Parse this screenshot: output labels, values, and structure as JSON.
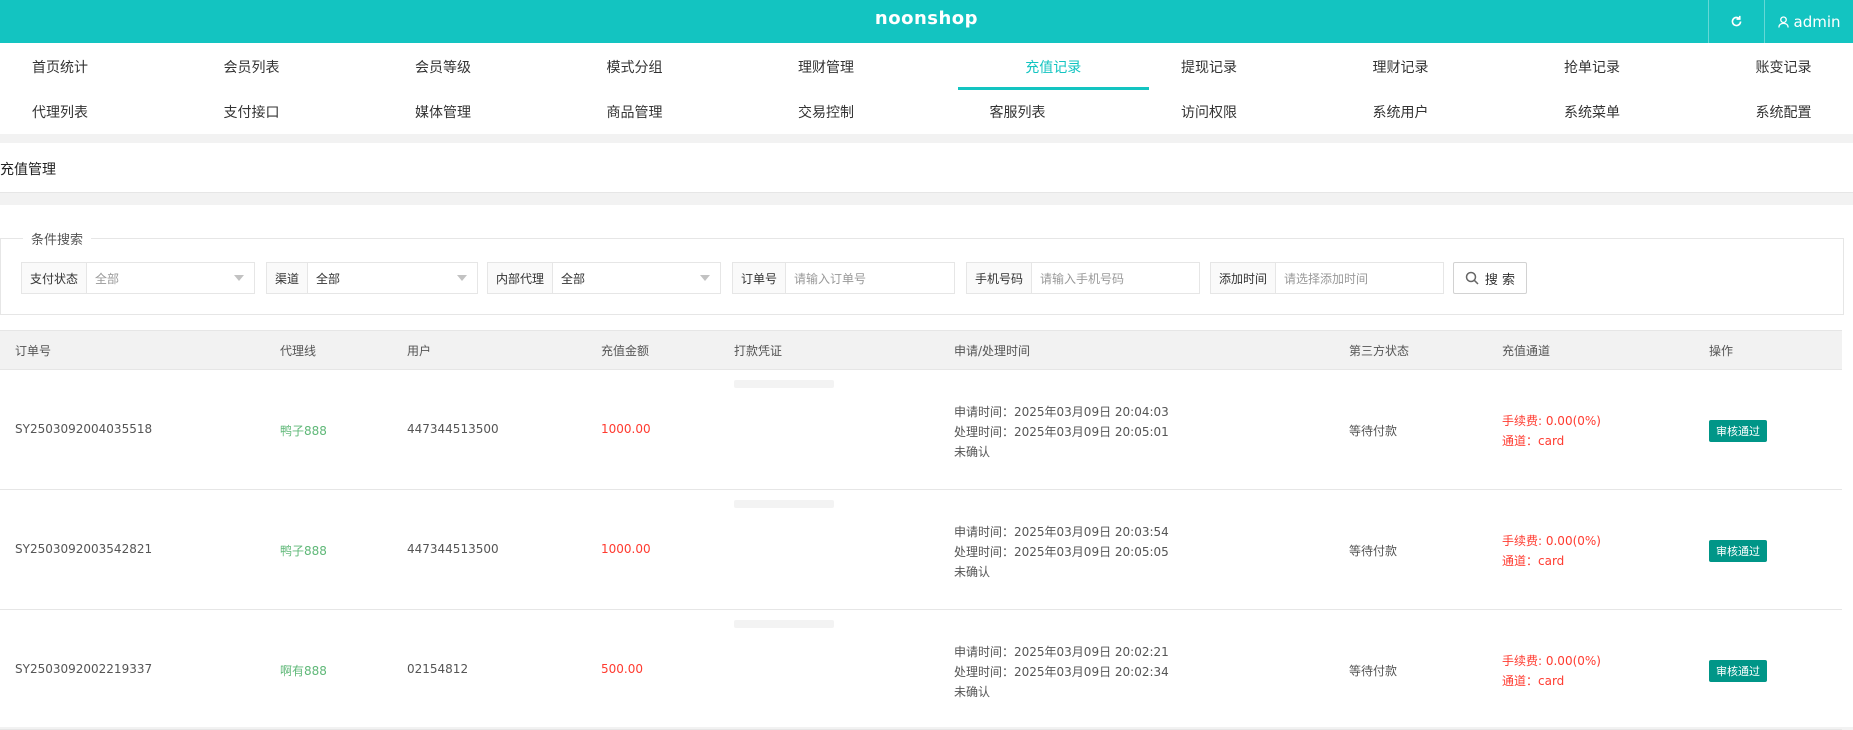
{
  "header": {
    "brand": "noonshop",
    "user": "admin",
    "refresh_icon": "refresh-icon",
    "user_icon": "user-icon"
  },
  "nav": {
    "row1": [
      "首页统计",
      "会员列表",
      "会员等级",
      "模式分组",
      "理财管理",
      "充值记录",
      "提现记录",
      "理财记录",
      "抢单记录",
      "账变记录"
    ],
    "row2": [
      "代理列表",
      "支付接口",
      "媒体管理",
      "商品管理",
      "交易控制",
      "客服列表",
      "访问权限",
      "系统用户",
      "系统菜单",
      "系统配置"
    ],
    "active": "充值记录"
  },
  "section": {
    "title": "充值管理"
  },
  "search": {
    "legend": "条件搜索",
    "pay_status": {
      "label": "支付状态",
      "value": "全部"
    },
    "channel": {
      "label": "渠道",
      "value": "全部"
    },
    "internal_agent": {
      "label": "内部代理",
      "value": "全部"
    },
    "order_no": {
      "label": "订单号",
      "placeholder": "请输入订单号"
    },
    "phone": {
      "label": "手机号码",
      "placeholder": "请输入手机号码"
    },
    "add_time": {
      "label": "添加时间",
      "placeholder": "请选择添加时间"
    },
    "button": "搜 索"
  },
  "table": {
    "columns": [
      "订单号",
      "代理线",
      "用户",
      "充值金额",
      "打款凭证",
      "申请/处理时间",
      "第三方状态",
      "充值通道",
      "操作"
    ],
    "rows": [
      {
        "order": "SY2503092004035518",
        "agent": "鸭子888",
        "user": "447344513500",
        "amount": "1000.00",
        "apply": "申请时间：2025年03月09日 20:04:03",
        "process": "处理时间：2025年03月09日 20:05:01",
        "confirm": "未确认",
        "third": "等待付款",
        "fee": "手续费: 0.00(0%)",
        "channel": "通道：card",
        "action": "审核通过"
      },
      {
        "order": "SY2503092003542821",
        "agent": "鸭子888",
        "user": "447344513500",
        "amount": "1000.00",
        "apply": "申请时间：2025年03月09日 20:03:54",
        "process": "处理时间：2025年03月09日 20:05:05",
        "confirm": "未确认",
        "third": "等待付款",
        "fee": "手续费: 0.00(0%)",
        "channel": "通道：card",
        "action": "审核通过"
      },
      {
        "order": "SY2503092002219337",
        "agent": "啊有888",
        "user": "02154812",
        "amount": "500.00",
        "apply": "申请时间：2025年03月09日 20:02:21",
        "process": "处理时间：2025年03月09日 20:02:34",
        "confirm": "未确认",
        "third": "等待付款",
        "fee": "手续费: 0.00(0%)",
        "channel": "通道：card",
        "action": "审核通过"
      }
    ]
  },
  "colors": {
    "accent": "#13c4c1",
    "approve": "#009688",
    "agent_text": "#5fb878",
    "money_text": "#ff3b30"
  }
}
